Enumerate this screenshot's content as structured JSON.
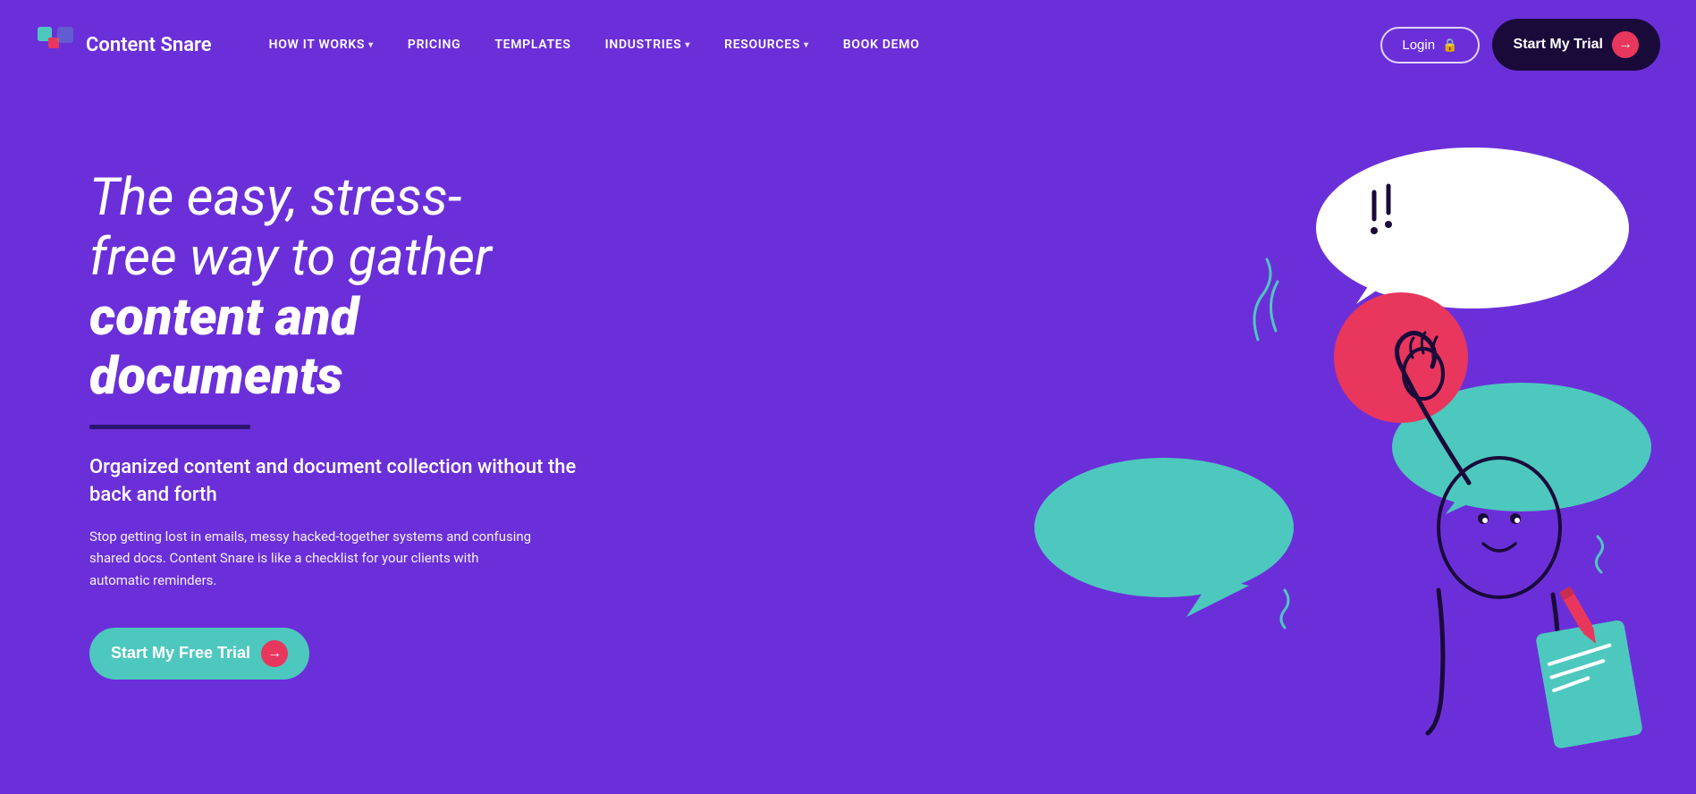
{
  "brand": {
    "name": "Content Snare",
    "logo_alt": "Content Snare Logo"
  },
  "nav": {
    "links": [
      {
        "id": "how-it-works",
        "label": "HOW IT WORKS",
        "has_dropdown": true
      },
      {
        "id": "pricing",
        "label": "PRICING",
        "has_dropdown": false
      },
      {
        "id": "templates",
        "label": "TEMPLATES",
        "has_dropdown": false
      },
      {
        "id": "industries",
        "label": "INDUSTRIES",
        "has_dropdown": true
      },
      {
        "id": "resources",
        "label": "RESOURCES",
        "has_dropdown": true
      },
      {
        "id": "book-demo",
        "label": "BOOK DEMO",
        "has_dropdown": false
      }
    ],
    "login_label": "Login",
    "trial_label": "Start My Trial"
  },
  "hero": {
    "title_line1": "The easy, stress-",
    "title_line2": "free way to gather",
    "title_bold": "content and",
    "title_bold2": "documents",
    "subtitle": "Organized content and document collection without the back and forth",
    "body": "Stop getting lost in emails, messy hacked-together systems and confusing shared docs. Content Snare is like a checklist for your clients with automatic reminders.",
    "cta_label": "Start My Free Trial"
  },
  "colors": {
    "bg": "#6B2FD9",
    "nav_dark": "#1a0a3a",
    "teal": "#4DC8BE",
    "pink": "#E8365D",
    "divider": "#2d1470"
  },
  "icons": {
    "chevron": "▾",
    "lock": "🔒",
    "arrow_right": "→"
  }
}
